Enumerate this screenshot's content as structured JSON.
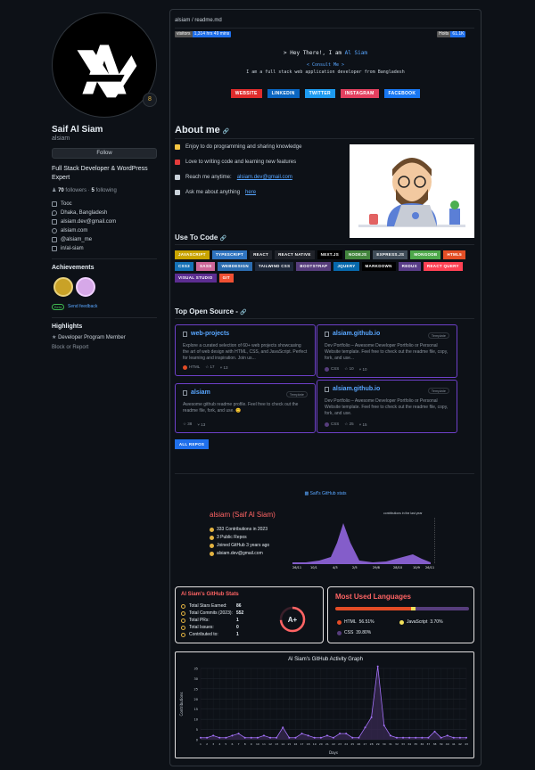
{
  "profile": {
    "name": "Saif Al Siam",
    "login": "alsiam",
    "status_emoji": "8",
    "follow_label": "Follow",
    "bio": "Full Stack Developer & WordPress Expert",
    "followers": "70",
    "followers_label": "followers",
    "following": "5",
    "following_label": "following",
    "company": "Tooc",
    "location": "Dhaka, Bangladesh",
    "email": "alsiam.dev@gmail.com",
    "website": "alsiam.com",
    "twitter": "@alsiam_me",
    "linkedin": "in/al-siam"
  },
  "achievements": {
    "title": "Achievements",
    "beta": "Beta",
    "feedback": "Send feedback"
  },
  "highlights": {
    "title": "Highlights",
    "item": "Developer Program Member",
    "block": "Block or Report"
  },
  "readme": {
    "path": "alsiam / readme.md",
    "visitors_label": "visitors",
    "visitors_value": "1,314 hrs 49 mins",
    "version_label": "Hoits",
    "version_value": "61.1K",
    "greeting": "> Hey There!, I am",
    "greeting_name": "Al Siam",
    "link": "< Consult Me >",
    "subtitle": "I am a full stack web application developer from Bangladesh",
    "socials": [
      {
        "label": "WEBSITE",
        "color": "#e02c2c"
      },
      {
        "label": "LINKEDIN",
        "color": "#0a66c2"
      },
      {
        "label": "TWITTER",
        "color": "#1d9bf0"
      },
      {
        "label": "INSTAGRAM",
        "color": "#e4405f"
      },
      {
        "label": "FACEBOOK",
        "color": "#1877f2"
      }
    ]
  },
  "about": {
    "title": "About me",
    "items": [
      {
        "text": "Enjoy to do programming and sharing knowledge",
        "color": "#f5c542"
      },
      {
        "text": "Love to writing code and learning new features",
        "color": "#e33b3b"
      },
      {
        "text": "Reach me anytime:",
        "link": "alsiam.dev@gmail.com",
        "color": "#c9d1d9"
      },
      {
        "text": "Ask me about anything",
        "link": "here",
        "color": "#c9d1d9"
      }
    ]
  },
  "tools": {
    "title": "Use To Code",
    "skills": [
      {
        "label": "JAVASCRIPT",
        "color": "#c9a400"
      },
      {
        "label": "TYPESCRIPT",
        "color": "#2f74c0"
      },
      {
        "label": "REACT",
        "color": "#20232a"
      },
      {
        "label": "REACT NATIVE",
        "color": "#20232a"
      },
      {
        "label": "NEXT.JS",
        "color": "#000000"
      },
      {
        "label": "NODEJS",
        "color": "#43853d"
      },
      {
        "label": "EXPRESS.JS",
        "color": "#404d59"
      },
      {
        "label": "MONGODB",
        "color": "#4ea94b"
      },
      {
        "label": "HTML5",
        "color": "#e34f26"
      },
      {
        "label": "CSS3",
        "color": "#1572b6"
      },
      {
        "label": "SASS",
        "color": "#cd6799"
      },
      {
        "label": "WEBDESIGN",
        "color": "#2b6cb0"
      },
      {
        "label": "TAILWIND CSS",
        "color": "#1e293b"
      },
      {
        "label": "BOOTSTRAP",
        "color": "#563d7c"
      },
      {
        "label": "JQUERY",
        "color": "#0769ad"
      },
      {
        "label": "MARKDOWN",
        "color": "#000000"
      },
      {
        "label": "REDUX",
        "color": "#593d88"
      },
      {
        "label": "REACT QUERY",
        "color": "#ff4154"
      },
      {
        "label": "VISUAL STUDIO",
        "color": "#5c2d91"
      },
      {
        "label": "GIT",
        "color": "#f05033"
      }
    ]
  },
  "repos": {
    "title": "Top Open Source -",
    "all_label": "ALL REPOS",
    "items": [
      {
        "name": "web-projects",
        "desc": "Explore a curated selection of 60+ web projects showcasing the art of web design with HTML, CSS, and JavaScript. Perfect for learning and inspiration. Join us...",
        "lang": "HTML",
        "lang_color": "#e34c26",
        "stars": "17",
        "forks": "13",
        "template": ""
      },
      {
        "name": "alsiam.github.io",
        "desc": "Dev Portfolio – Awesome Developer Portfolio or Personal Website template. Feel free to check out the readme file, copy, fork, and use...",
        "lang": "CSS",
        "lang_color": "#563d7c",
        "stars": "10",
        "forks": "10",
        "template": "Template"
      },
      {
        "name": "alsiam",
        "desc": "Awesome github readme profile. Feel free to check out the readme file, fork, and use. 😊",
        "lang": "",
        "lang_color": "",
        "stars": "38",
        "forks": "13",
        "template": "Template"
      },
      {
        "name": "alsiam.github.io",
        "desc": "Dev Portfolio – Awesome Developer Portfolio or Personal Website template. Feel free to check out the readme file, copy, fork, and use.",
        "lang": "CSS",
        "lang_color": "#563d7c",
        "stars": "25",
        "forks": "15",
        "template": "Template"
      }
    ]
  },
  "ghcard": {
    "broken_alt": "Saif's GitHub stats",
    "title": "alsiam (Saif Al Siam)",
    "lines": [
      "333 Contributions in 2023",
      "3 Public Repos",
      "Joined GitHub 3 years ago",
      "alsiam.dev@gmail.com"
    ],
    "legend": "contributions in the last year"
  },
  "stats": {
    "title": "Al Siam's GitHub Stats",
    "rows": [
      {
        "label": "Total Stars Earned:",
        "value": "86"
      },
      {
        "label": "Total Commits (2023):",
        "value": "552"
      },
      {
        "label": "Total PRs:",
        "value": "1"
      },
      {
        "label": "Total Issues:",
        "value": "0"
      },
      {
        "label": "Contributed to:",
        "value": "1"
      }
    ],
    "rank": "A+"
  },
  "langs": {
    "title": "Most Used Languages",
    "items": [
      {
        "name": "HTML",
        "pct": "56.51%",
        "value": 56.51,
        "color": "#e34c26"
      },
      {
        "name": "JavaScript",
        "pct": "3.70%",
        "value": 3.7,
        "color": "#f1e05a"
      },
      {
        "name": "CSS",
        "pct": "39.80%",
        "value": 39.8,
        "color": "#563d7c"
      }
    ]
  },
  "chart_data": {
    "type": "area",
    "title": "Al Siam's GitHub Activity Graph",
    "xlabel": "Days",
    "ylabel": "Contributions",
    "ylim": [
      0,
      35
    ],
    "yticks": [
      0,
      5,
      10,
      15,
      20,
      25,
      30,
      35
    ],
    "values": [
      1,
      1,
      2,
      1,
      1,
      2,
      3,
      1,
      1,
      1,
      2,
      1,
      1,
      6,
      1,
      1,
      3,
      2,
      1,
      1,
      2,
      1,
      3,
      3,
      1,
      1,
      6,
      11,
      36,
      7,
      2,
      1,
      1,
      1,
      1,
      1,
      1,
      4,
      1,
      2,
      1,
      1,
      1
    ]
  }
}
